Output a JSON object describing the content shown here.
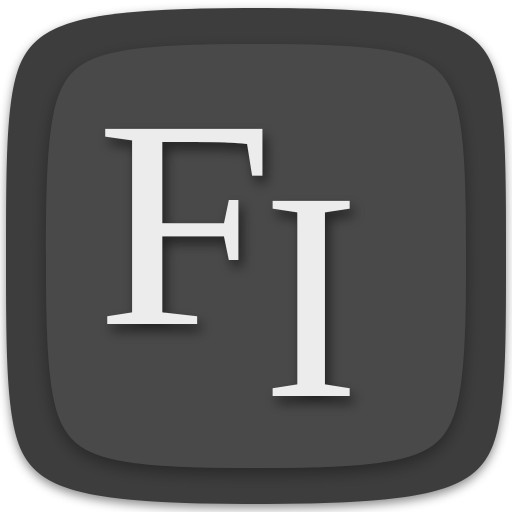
{
  "app_icon": {
    "letter_f": "F",
    "letter_i": "I",
    "colors": {
      "outer_tile": "#3d3d3d",
      "inner_tile": "#4a4a4a",
      "glyph": "#ececec"
    }
  }
}
